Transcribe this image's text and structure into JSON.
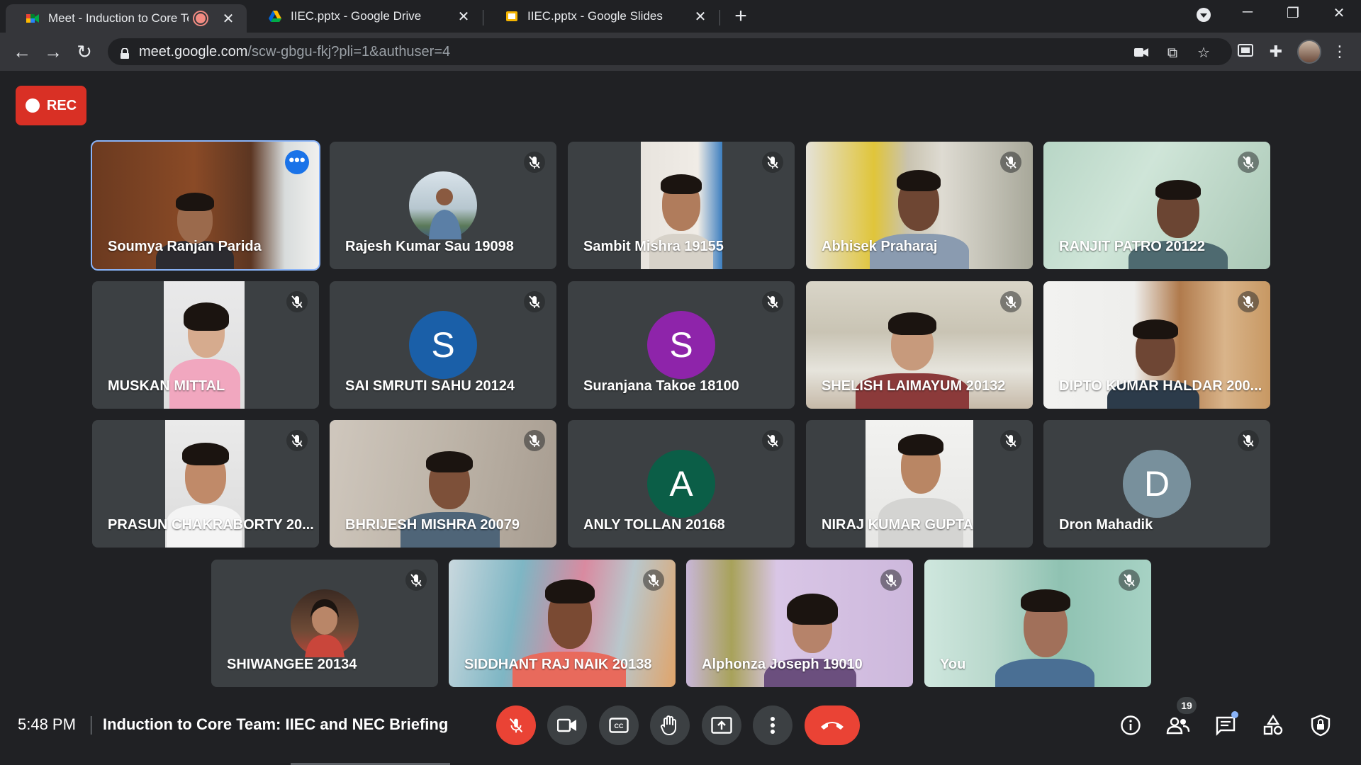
{
  "browser": {
    "tabs": [
      {
        "title": "Meet - Induction to Core Tea",
        "icon": "google-meet-icon",
        "active": true
      },
      {
        "title": "IIEC.pptx - Google Drive",
        "icon": "google-drive-icon",
        "active": false
      },
      {
        "title": "IIEC.pptx - Google Slides",
        "icon": "google-slides-icon",
        "active": false
      }
    ],
    "url_host": "meet.google.com",
    "url_path": "/scw-gbgu-fkj?pli=1&authuser=4"
  },
  "meet": {
    "rec_label": "REC",
    "participants": [
      {
        "name": "Soumya Ranjan Parida",
        "type": "video",
        "speaking": true
      },
      {
        "name": "Rajesh Kumar Sau 19098",
        "type": "photo",
        "muted": true
      },
      {
        "name": "Sambit Mishra 19155",
        "type": "video",
        "muted": true
      },
      {
        "name": "Abhisek Praharaj",
        "type": "video",
        "muted": true
      },
      {
        "name": "RANJIT PATRO 20122",
        "type": "video",
        "muted": true
      },
      {
        "name": "MUSKAN MITTAL",
        "type": "video",
        "muted": true
      },
      {
        "name": "SAI SMRUTI SAHU 20124",
        "type": "initial",
        "initial": "S",
        "color": "#1a5fa8",
        "muted": true
      },
      {
        "name": "Suranjana Takoe 18100",
        "type": "initial",
        "initial": "S",
        "color": "#8e24aa",
        "muted": true
      },
      {
        "name": "SHELISH LAIMAYUM 20132",
        "type": "video",
        "muted": true
      },
      {
        "name": "DIPTO KUMAR HALDAR 200...",
        "type": "video",
        "muted": true
      },
      {
        "name": "PRASUN CHAKRABORTY 20...",
        "type": "video",
        "muted": true
      },
      {
        "name": "BHRIJESH MISHRA 20079",
        "type": "video",
        "muted": true
      },
      {
        "name": "ANLY TOLLAN 20168",
        "type": "initial",
        "initial": "A",
        "color": "#0b5e47",
        "muted": true
      },
      {
        "name": "NIRAJ KUMAR GUPTA",
        "type": "video",
        "muted": true
      },
      {
        "name": "Dron Mahadik",
        "type": "initial",
        "initial": "D",
        "color": "#78909c",
        "muted": true
      },
      {
        "name": "SHIWANGEE 20134",
        "type": "photo",
        "muted": true
      },
      {
        "name": "SIDDHANT RAJ NAIK 20138",
        "type": "video",
        "muted": true
      },
      {
        "name": "Alphonza Joseph 19010",
        "type": "video",
        "muted": true
      },
      {
        "name": "You",
        "type": "video",
        "muted": true
      }
    ],
    "bottom_bar": {
      "time": "5:48 PM",
      "meeting_title": "Induction to Core Team: IIEC and NEC Briefing",
      "participant_count": "19"
    }
  }
}
